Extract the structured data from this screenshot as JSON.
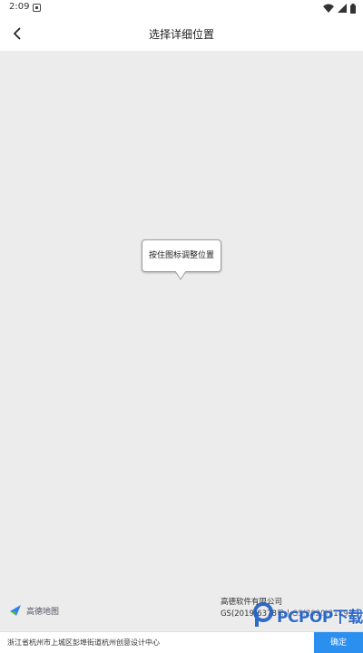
{
  "status_bar": {
    "time": "2:09",
    "icons": [
      "notification-icon",
      "wifi-icon",
      "signal-icon",
      "battery-icon"
    ]
  },
  "header": {
    "title": "选择详细位置",
    "back_icon": "chevron-left-icon"
  },
  "map": {
    "tooltip": "按住图标调整位置",
    "logo_text": "高德地图",
    "copyright_company": "高德软件有限公司",
    "copyright_codes": "GS(2019)6378号 | GS(2020)2189号"
  },
  "bottom_bar": {
    "address": "浙江省杭州市上城区彭埠街道杭州创意设计中心",
    "confirm_label": "确定"
  },
  "watermark": {
    "text": "PCPOP下载"
  },
  "colors": {
    "map_background": "#ececec",
    "accent": "#2b8ff0",
    "watermark": "#1f5fc4"
  }
}
